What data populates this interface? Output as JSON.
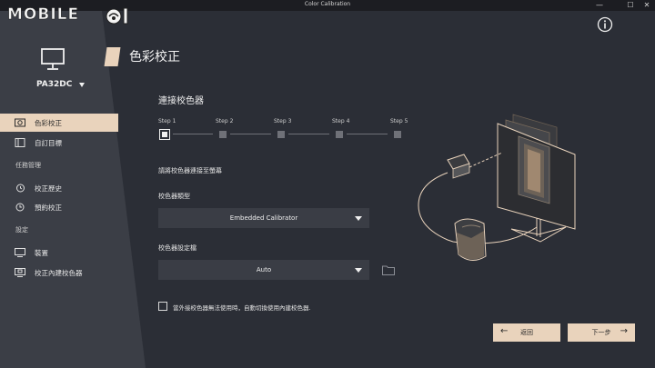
{
  "window": {
    "title": "Color Calibration",
    "min": "—",
    "max": "☐",
    "close": "✕"
  },
  "watermark": {
    "text": "MOBILE"
  },
  "device": {
    "name": "PA32DC",
    "icon": "monitor-icon"
  },
  "nav": {
    "items": [
      {
        "label": "色彩校正",
        "icon": "calibration-icon",
        "active": true
      },
      {
        "label": "自訂目標",
        "icon": "custom-target-icon",
        "active": false
      }
    ],
    "task_heading": "任務管理",
    "task_items": [
      {
        "label": "校正歷史",
        "icon": "history-icon"
      },
      {
        "label": "預約校正",
        "icon": "schedule-icon"
      }
    ],
    "settings_heading": "設定",
    "settings_items": [
      {
        "label": "裝置",
        "icon": "device-icon"
      },
      {
        "label": "校正內建校色器",
        "icon": "builtin-calibrator-icon"
      }
    ]
  },
  "main": {
    "title": "色彩校正",
    "section_title": "連接校色器",
    "steps": [
      "Step 1",
      "Step 2",
      "Step 3",
      "Step 4",
      "Step 5"
    ],
    "current_step": 1,
    "instruction": "請將校色器連接至螢幕",
    "calibrator_type_label": "校色器類型",
    "calibrator_type_value": "Embedded Calibrator",
    "profile_label": "校色器設定檔",
    "profile_value": "Auto",
    "fallback_text": "當外接校色器無法使用時，自動切換使用內建校色器.",
    "fallback_checked": false,
    "back_label": "返回",
    "next_label": "下一步"
  },
  "colors": {
    "accent": "#e9d3bc",
    "background": "#2b2e36",
    "sidebar": "#3b3e46"
  }
}
